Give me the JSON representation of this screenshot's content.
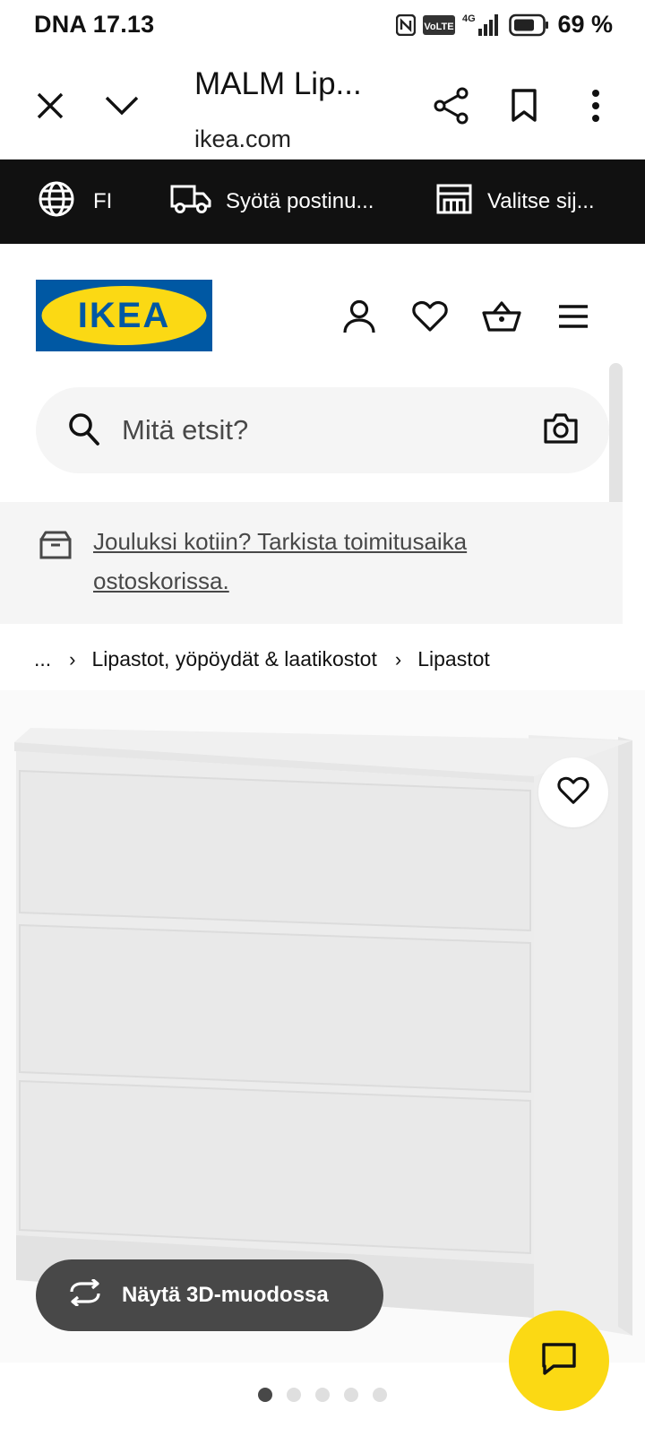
{
  "status_bar": {
    "carrier_time": "DNA 17.13",
    "volte": "VoLTE",
    "network": "4G",
    "battery": "69 %"
  },
  "custom_tab": {
    "title": "MALM Lip...",
    "url": "ikea.com",
    "icons": [
      "close-icon",
      "chevron-down-icon",
      "share-icon",
      "bookmark-icon",
      "more-vert-icon"
    ]
  },
  "top_bar": {
    "language": "FI",
    "postcode": "Syötä postinu...",
    "store": "Valitse sij..."
  },
  "header": {
    "logo_text": "IKEA",
    "icons": [
      "profile-icon",
      "heart-icon",
      "basket-icon",
      "menu-icon"
    ]
  },
  "search": {
    "placeholder": "Mitä etsit?"
  },
  "notice": {
    "text": "Jouluksi kotiin? Tarkista toimitusaika ostoskorissa."
  },
  "breadcrumbs": {
    "ellipsis": "...",
    "items": [
      "Lipastot, yöpöydät & laatikostot",
      "Lipastot"
    ]
  },
  "product": {
    "view_3d_label": "Näytä 3D-muodossa",
    "image_count": 5,
    "active_image": 1,
    "colors": {
      "brand_yellow": "#fbd914",
      "brand_blue": "#0058a3"
    }
  }
}
